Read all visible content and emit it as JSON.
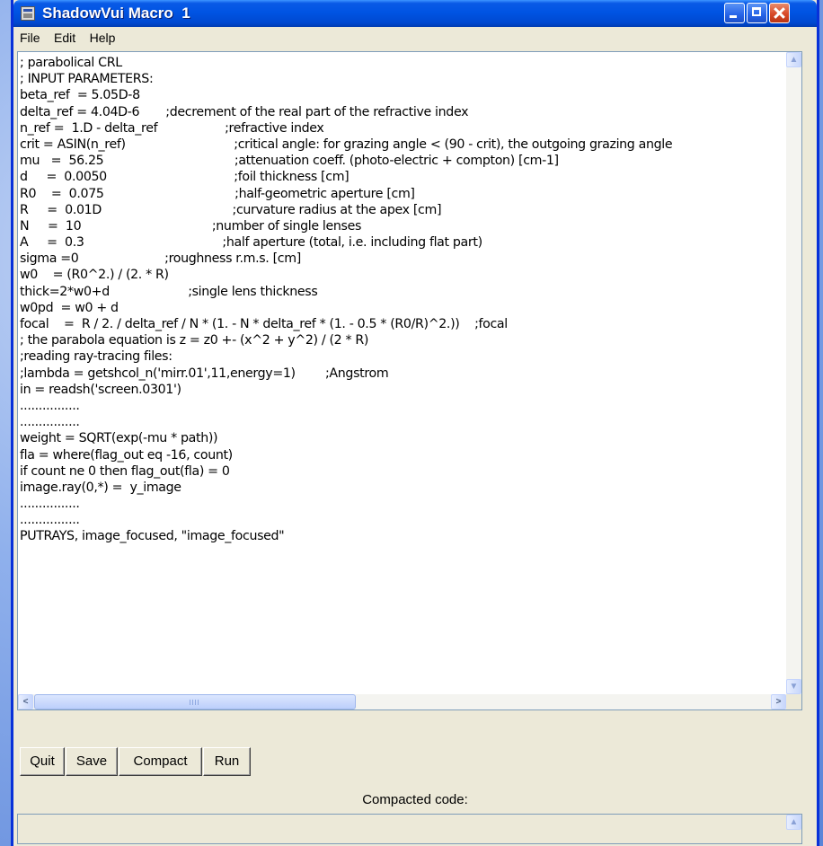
{
  "window": {
    "title": "ShadowVui Macro  1"
  },
  "menu": {
    "items": [
      "File",
      "Edit",
      "Help"
    ]
  },
  "editor": {
    "lines": [
      "; parabolical CRL",
      "; INPUT PARAMETERS:",
      "beta_ref  = 5.05D-8",
      "delta_ref = 4.04D-6       ;decrement of the real part of the refractive index",
      "n_ref =  1.D - delta_ref                  ;refractive index",
      "crit = ASIN(n_ref)                             ;critical angle: for grazing angle < (90 - crit), the outgoing grazing angle",
      "mu   =  56.25                                   ;attenuation coeff. (photo-electric + compton) [cm-1]",
      "d     =  0.0050                                  ;foil thickness [cm]",
      "R0    =  0.075                                   ;half-geometric aperture [cm]",
      "R     =  0.01D                                   ;curvature radius at the apex [cm]",
      "N     =  10                                   ;number of single lenses",
      "A     =  0.3                                     ;half aperture (total, i.e. including flat part)",
      "sigma =0                       ;roughness r.m.s. [cm]",
      "w0    = (R0^2.) / (2. * R)",
      "thick=2*w0+d                     ;single lens thickness",
      "w0pd  = w0 + d",
      "focal    =  R / 2. / delta_ref / N * (1. - N * delta_ref * (1. - 0.5 * (R0/R)^2.))    ;focal",
      "; the parabola equation is z = z0 +- (x^2 + y^2) / (2 * R)",
      ";reading ray-tracing files:",
      ";lambda = getshcol_n('mirr.01',11,energy=1)        ;Angstrom",
      "in = readsh('screen.0301')",
      "................",
      "................",
      "weight = SQRT(exp(-mu * path))",
      "fla = where(flag_out eq -16, count)",
      "if count ne 0 then flag_out(fla) = 0",
      "image.ray(0,*) =  y_image",
      "................",
      "................",
      "PUTRAYS, image_focused, \"image_focused\""
    ]
  },
  "buttons": {
    "quit": "Quit",
    "save": "Save",
    "compact": "Compact",
    "run": "Run"
  },
  "compacted": {
    "label": "Compacted code:",
    "value": ""
  },
  "icons": {
    "app": "app-icon",
    "minimize": "minimize-icon",
    "maximize": "maximize-icon",
    "close": "close-icon",
    "scroll_up": "arrow-up-icon",
    "scroll_down": "arrow-down-icon",
    "scroll_left": "arrow-left-icon",
    "scroll_right": "arrow-right-icon"
  },
  "colors": {
    "titlebar": "#0054e3",
    "window_bg": "#ece9d8",
    "close_button": "#d84a2a"
  }
}
